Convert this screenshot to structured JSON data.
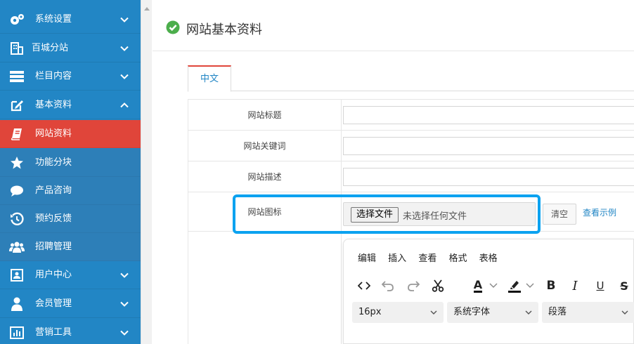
{
  "sidebar": {
    "items": [
      {
        "label": "系统设置",
        "icon": "gears-icon"
      },
      {
        "label": "百城分站",
        "icon": "building-icon"
      },
      {
        "label": "栏目内容",
        "icon": "columns-icon"
      },
      {
        "label": "基本资料",
        "icon": "edit-icon"
      },
      {
        "label": "网站资料",
        "icon": "book-icon"
      },
      {
        "label": "功能分块",
        "icon": "star-icon"
      },
      {
        "label": "产品咨询",
        "icon": "comment-icon"
      },
      {
        "label": "预约反馈",
        "icon": "history-icon"
      },
      {
        "label": "招聘管理",
        "icon": "users-icon"
      },
      {
        "label": "用户中心",
        "icon": "user-card-icon"
      },
      {
        "label": "会员管理",
        "icon": "user-icon"
      },
      {
        "label": "营销工具",
        "icon": "bar-chart-icon"
      }
    ],
    "active_color": "#e0453a",
    "bg_color": "#2286c5"
  },
  "header": {
    "title": "网站基本资料"
  },
  "tabs": [
    {
      "label": "中文"
    }
  ],
  "form": {
    "rows": [
      {
        "label": "网站标题"
      },
      {
        "label": "网站关键词"
      },
      {
        "label": "网站描述"
      },
      {
        "label": "网站图标"
      }
    ],
    "file_button": "选择文件",
    "file_status": "未选择任何文件",
    "clear_button": "清空",
    "example_link": "查看示例"
  },
  "editor": {
    "menu": [
      "编辑",
      "插入",
      "查看",
      "格式",
      "表格"
    ],
    "toolbar": [
      "code-icon",
      "undo-icon",
      "redo-icon",
      "cut-icon",
      "font-color-icon",
      "highlight-icon",
      "bold-icon",
      "italic-icon",
      "underline-icon",
      "strikethrough-icon"
    ],
    "bold": "B",
    "italic": "I",
    "underline": "U",
    "strike": "S",
    "font_color": "A",
    "font_size": "16px",
    "font_family": "系统字体",
    "block_format": "段落"
  }
}
